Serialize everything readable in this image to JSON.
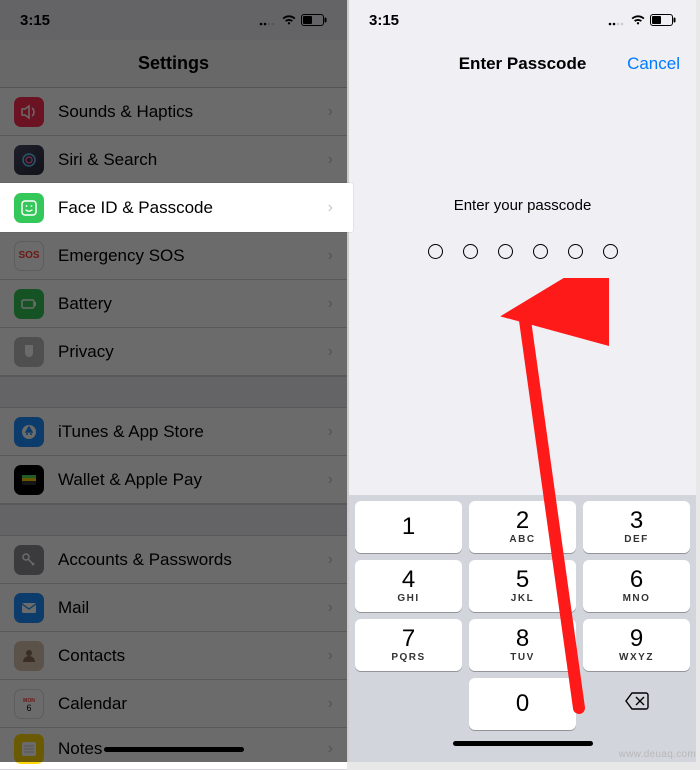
{
  "status": {
    "time": "3:15"
  },
  "left": {
    "title": "Settings",
    "rows": [
      {
        "label": "Sounds & Haptics",
        "icon": "sounds",
        "bg": "#ff2d55"
      },
      {
        "label": "Siri & Search",
        "icon": "siri",
        "bg": "#222"
      },
      {
        "label": "Face ID & Passcode",
        "icon": "faceid",
        "bg": "#34c759",
        "highlight": true
      },
      {
        "label": "Emergency SOS",
        "icon": "sos",
        "bg": "#fff"
      },
      {
        "label": "Battery",
        "icon": "battery",
        "bg": "#34c759"
      },
      {
        "label": "Privacy",
        "icon": "privacy",
        "bg": "#bdbdbd"
      }
    ],
    "rows2": [
      {
        "label": "iTunes & App Store",
        "icon": "appstore",
        "bg": "#1e8fff"
      },
      {
        "label": "Wallet & Apple Pay",
        "icon": "wallet",
        "bg": "#000"
      }
    ],
    "rows3": [
      {
        "label": "Accounts & Passwords",
        "icon": "key",
        "bg": "#8e8e93"
      },
      {
        "label": "Mail",
        "icon": "mail",
        "bg": "#1e8fff"
      },
      {
        "label": "Contacts",
        "icon": "contacts",
        "bg": "#b08060"
      },
      {
        "label": "Calendar",
        "icon": "calendar",
        "bg": "#fff"
      },
      {
        "label": "Notes",
        "icon": "notes",
        "bg": "#ffd60a"
      }
    ]
  },
  "right": {
    "title": "Enter Passcode",
    "cancel": "Cancel",
    "prompt": "Enter your passcode",
    "keys": [
      {
        "n": "1",
        "s": ""
      },
      {
        "n": "2",
        "s": "ABC"
      },
      {
        "n": "3",
        "s": "DEF"
      },
      {
        "n": "4",
        "s": "GHI"
      },
      {
        "n": "5",
        "s": "JKL"
      },
      {
        "n": "6",
        "s": "MNO"
      },
      {
        "n": "7",
        "s": "PQRS"
      },
      {
        "n": "8",
        "s": "TUV"
      },
      {
        "n": "9",
        "s": "WXYZ"
      },
      {
        "n": "",
        "s": "",
        "blank": true
      },
      {
        "n": "0",
        "s": ""
      },
      {
        "n": "⌫",
        "s": "",
        "del": true
      }
    ]
  },
  "watermark": "www.deuaq.com"
}
